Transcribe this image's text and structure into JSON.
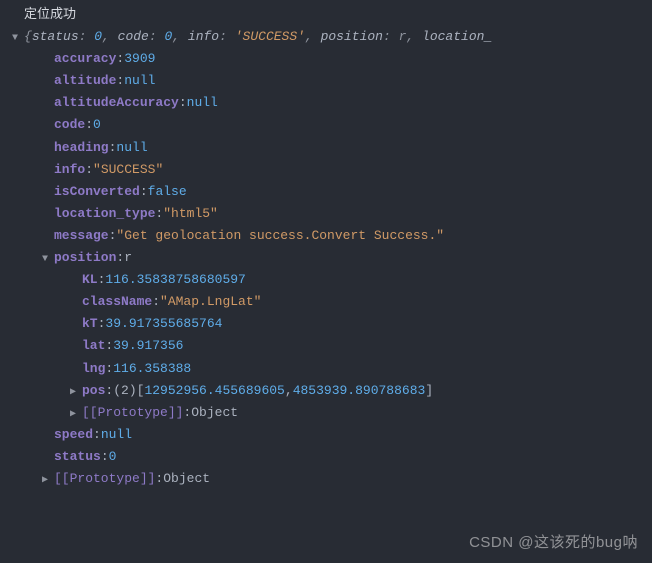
{
  "log_message": "定位成功",
  "summary": {
    "open_brace": "{",
    "items": [
      {
        "k": "status",
        "v": "0",
        "t": "num"
      },
      {
        "k": "code",
        "v": "0",
        "t": "num"
      },
      {
        "k": "info",
        "v": "'SUCCESS'",
        "t": "str"
      },
      {
        "k": "position",
        "v": "r",
        "t": "dim"
      },
      {
        "k": "location_",
        "v": "",
        "t": ""
      }
    ]
  },
  "obj": {
    "accuracy": {
      "value": "3909",
      "type": "num"
    },
    "altitude": {
      "value": "null",
      "type": "kw"
    },
    "altitudeAccuracy": {
      "value": "null",
      "type": "kw"
    },
    "code": {
      "value": "0",
      "type": "num"
    },
    "heading": {
      "value": "null",
      "type": "kw"
    },
    "info": {
      "value": "\"SUCCESS\"",
      "type": "str"
    },
    "isConverted": {
      "value": "false",
      "type": "kw"
    },
    "location_type": {
      "value": "\"html5\"",
      "type": "str"
    },
    "message": {
      "value": "\"Get geolocation success.Convert Success.\"",
      "type": "str"
    },
    "position_label": "position",
    "position_preview": "r",
    "position": {
      "KL": {
        "value": "116.35838758680597",
        "type": "num"
      },
      "className": {
        "value": "\"AMap.LngLat\"",
        "type": "str"
      },
      "kT": {
        "value": "39.917355685764",
        "type": "num"
      },
      "lat": {
        "value": "39.917356",
        "type": "num"
      },
      "lng": {
        "value": "116.358388",
        "type": "num"
      },
      "pos_label": "pos",
      "pos_len": "(2)",
      "pos_0": "12952956.455689605",
      "pos_1": "4853939.890788683",
      "proto_label": "[[Prototype]]",
      "proto_value": "Object"
    },
    "speed": {
      "value": "null",
      "type": "kw"
    },
    "status": {
      "value": "0",
      "type": "num"
    },
    "proto_label": "[[Prototype]]",
    "proto_value": "Object"
  },
  "labels": {
    "accuracy": "accuracy",
    "altitude": "altitude",
    "altitudeAccuracy": "altitudeAccuracy",
    "code": "code",
    "heading": "heading",
    "info": "info",
    "isConverted": "isConverted",
    "location_type": "location_type",
    "message": "message",
    "speed": "speed",
    "status": "status",
    "KL": "KL",
    "className": "className",
    "kT": "kT",
    "lat": "lat",
    "lng": "lng"
  },
  "punct": {
    "colon": ": ",
    "comma": ", ",
    "lb": "[",
    "rb": "]"
  },
  "watermark": "CSDN @这该死的bug呐"
}
